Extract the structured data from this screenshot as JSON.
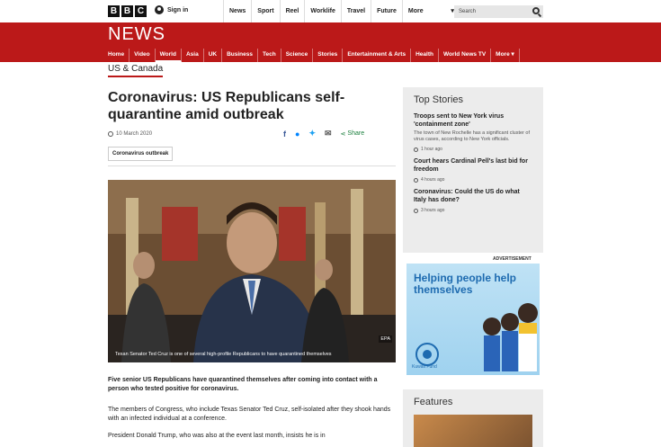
{
  "topbar": {
    "logo_letters": [
      "B",
      "B",
      "C"
    ],
    "signin_label": "Sign in",
    "nav": [
      "News",
      "Sport",
      "Reel",
      "Worklife",
      "Travel",
      "Future"
    ],
    "more_label": "More",
    "search_placeholder": "Search"
  },
  "news": {
    "title": "NEWS",
    "nav": [
      "Home",
      "Video",
      "World",
      "Asia",
      "UK",
      "Business",
      "Tech",
      "Science",
      "Stories",
      "Entertainment & Arts",
      "Health",
      "World News TV",
      "More ▾"
    ],
    "active": "World"
  },
  "section": "US & Canada",
  "article": {
    "headline": "Coronavirus: US Republicans self-quarantine amid outbreak",
    "date": "10 March 2020",
    "share_label": "Share",
    "tag": "Coronavirus outbreak",
    "photo_caption": "Texan Senator Ted Cruz is one of several high-profile Republicans to have quarantined themselves",
    "photo_credit": "EPA",
    "lead": "Five senior US Republicans have quarantined themselves after coming into contact with a person who tested positive for coronavirus.",
    "p2": "The members of Congress, who include Texas Senator Ted Cruz, self-isolated after they shook hands with an infected individual at a conference.",
    "p3": "President Donald Trump, who was also at the event last month, insists he is in"
  },
  "sidebar": {
    "top_stories_title": "Top Stories",
    "stories": [
      {
        "title": "Troops sent to New York virus 'containment zone'",
        "desc": "The town of New Rochelle has a significant cluster of virus cases, according to New York officials.",
        "time": "1 hour ago"
      },
      {
        "title": "Court hears Cardinal Pell's last bid for freedom",
        "desc": "",
        "time": "4 hours ago"
      },
      {
        "title": "Coronavirus: Could the US do what Italy has done?",
        "desc": "",
        "time": "3 hours ago"
      }
    ],
    "ad_label": "ADVERTISEMENT",
    "ad_text": "Helping people help themselves",
    "ad_logo_text": "Kuwait Fund",
    "features_title": "Features"
  },
  "colors": {
    "brand_red": "#bb1919",
    "share_green": "#1a7f3c",
    "facebook": "#3b5998",
    "messenger": "#0084ff",
    "twitter": "#1da1f2"
  }
}
